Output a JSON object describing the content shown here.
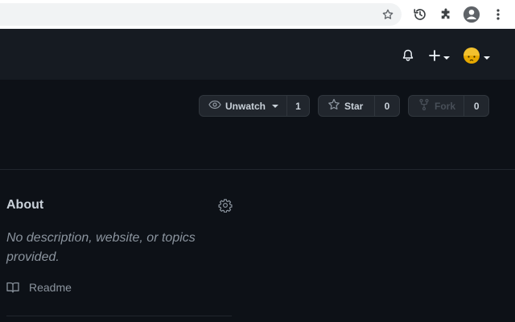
{
  "colors": {
    "page_bg": "#0d1117",
    "header_bg": "#161b22",
    "button_bg": "#21262d",
    "border": "#30363d",
    "text": "#c9d1d9",
    "muted": "#8b949e",
    "avatar": "#f0b400"
  },
  "browser": {
    "icons": [
      "bookmark-star-icon",
      "history-icon",
      "extensions-icon",
      "profile-icon",
      "kebab-menu-icon"
    ]
  },
  "header": {
    "icons": [
      "notification-bell-icon",
      "plus-icon",
      "avatar"
    ]
  },
  "repo_actions": {
    "watch": {
      "label": "Unwatch",
      "count": "1",
      "icon": "eye-icon"
    },
    "star": {
      "label": "Star",
      "count": "0",
      "icon": "star-icon"
    },
    "fork": {
      "label": "Fork",
      "count": "0",
      "icon": "fork-icon"
    }
  },
  "about": {
    "title": "About",
    "description": "No description, website, or topics provided.",
    "readme_label": "Readme",
    "icons": [
      "gear-icon",
      "book-icon"
    ]
  }
}
